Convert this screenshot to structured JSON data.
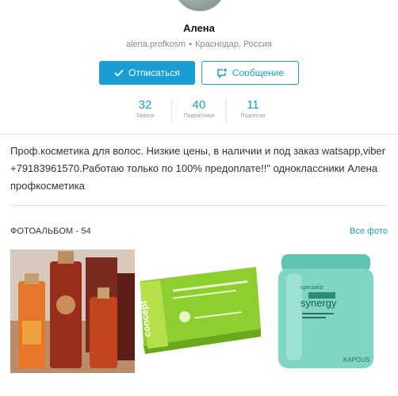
{
  "profile": {
    "name": "Алена",
    "username": "alena.profkosm",
    "separator": "•",
    "location": "Краснодар, Россия"
  },
  "actions": {
    "unsubscribe_label": "Отписаться",
    "message_label": "Сообщение"
  },
  "stats": [
    {
      "value": "32",
      "label": "Записи"
    },
    {
      "value": "40",
      "label": "Подписчики"
    },
    {
      "value": "11",
      "label": "Подписки"
    }
  ],
  "bio": {
    "text": "Проф.косметика для волос. Низкие цены, в наличии и под заказ watsapp,viber +79183961570.Работаю только по 100% предоплате!!\" одноклассники Алена профкосметика"
  },
  "album": {
    "title": "ФОТОАЛЬБОМ - 54",
    "link_label": "Все фото"
  },
  "colors": {
    "accent": "#1a9fd4",
    "muted": "#8a8a8a"
  },
  "photos": [
    {
      "icon": "bottles-photo"
    },
    {
      "icon": "ampoule-box-photo",
      "brand_text": "concept"
    },
    {
      "icon": "mask-jar-photo",
      "brand_text": "synergy"
    }
  ]
}
